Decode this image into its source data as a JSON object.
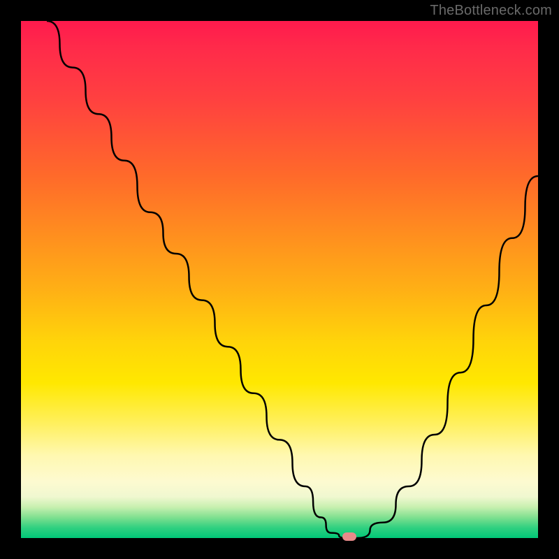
{
  "watermark": "TheBottleneck.com",
  "colors": {
    "frame": "#000000",
    "curve": "#000000",
    "marker": "#e88a8a"
  },
  "chart_data": {
    "type": "line",
    "title": "",
    "xlabel": "",
    "ylabel": "",
    "xlim": [
      0,
      100
    ],
    "ylim": [
      0,
      100
    ],
    "grid": false,
    "series": [
      {
        "name": "bottleneck-curve",
        "x": [
          5,
          10,
          15,
          20,
          25,
          30,
          35,
          40,
          45,
          50,
          55,
          58,
          60,
          63,
          65,
          70,
          75,
          80,
          85,
          90,
          95,
          100
        ],
        "values": [
          100,
          91,
          82,
          73,
          63,
          55,
          46,
          37,
          28,
          19,
          10,
          4,
          1,
          0,
          0,
          3,
          10,
          20,
          32,
          45,
          58,
          70
        ]
      }
    ],
    "markers": [
      {
        "name": "optimal-point",
        "x": 63.5,
        "y": 0,
        "color": "#e88a8a"
      }
    ],
    "background_gradient": [
      {
        "stop": 0,
        "color": "#ff1a4d"
      },
      {
        "stop": 50,
        "color": "#ffb500"
      },
      {
        "stop": 80,
        "color": "#fff060"
      },
      {
        "stop": 100,
        "color": "#00c878"
      }
    ]
  }
}
